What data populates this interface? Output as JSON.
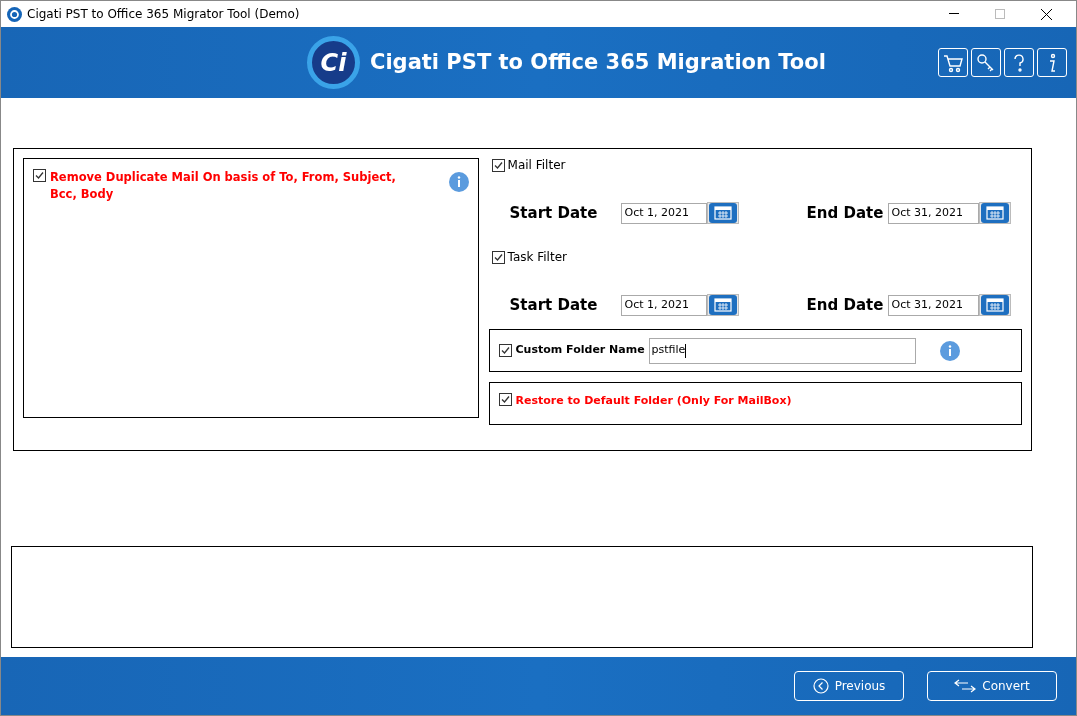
{
  "window": {
    "title": "Cigati PST to Office 365 Migrator Tool (Demo)"
  },
  "header": {
    "logo_text": "Ci",
    "title": "Cigati PST to Office 365 Migration Tool"
  },
  "duplicate": {
    "label": "Remove Duplicate Mail On basis of To, From, Subject, Bcc, Body",
    "checked": true
  },
  "filters": [
    {
      "label": "Mail Filter",
      "checked": true,
      "start_label": "Start Date",
      "start": "Oct 1, 2021",
      "end_label": "End Date",
      "end": "Oct 31, 2021"
    },
    {
      "label": "Task Filter",
      "checked": true,
      "start_label": "Start Date",
      "start": "Oct 1, 2021",
      "end_label": "End Date",
      "end": "Oct 31, 2021"
    }
  ],
  "custom_folder": {
    "label": "Custom Folder Name",
    "checked": true,
    "value": "pstfile"
  },
  "restore": {
    "label": "Restore to Default Folder (Only For MailBox)",
    "checked": true
  },
  "buttons": [
    {
      "kind": "previous",
      "label": "Previous"
    },
    {
      "kind": "convert",
      "label": "Convert"
    }
  ]
}
